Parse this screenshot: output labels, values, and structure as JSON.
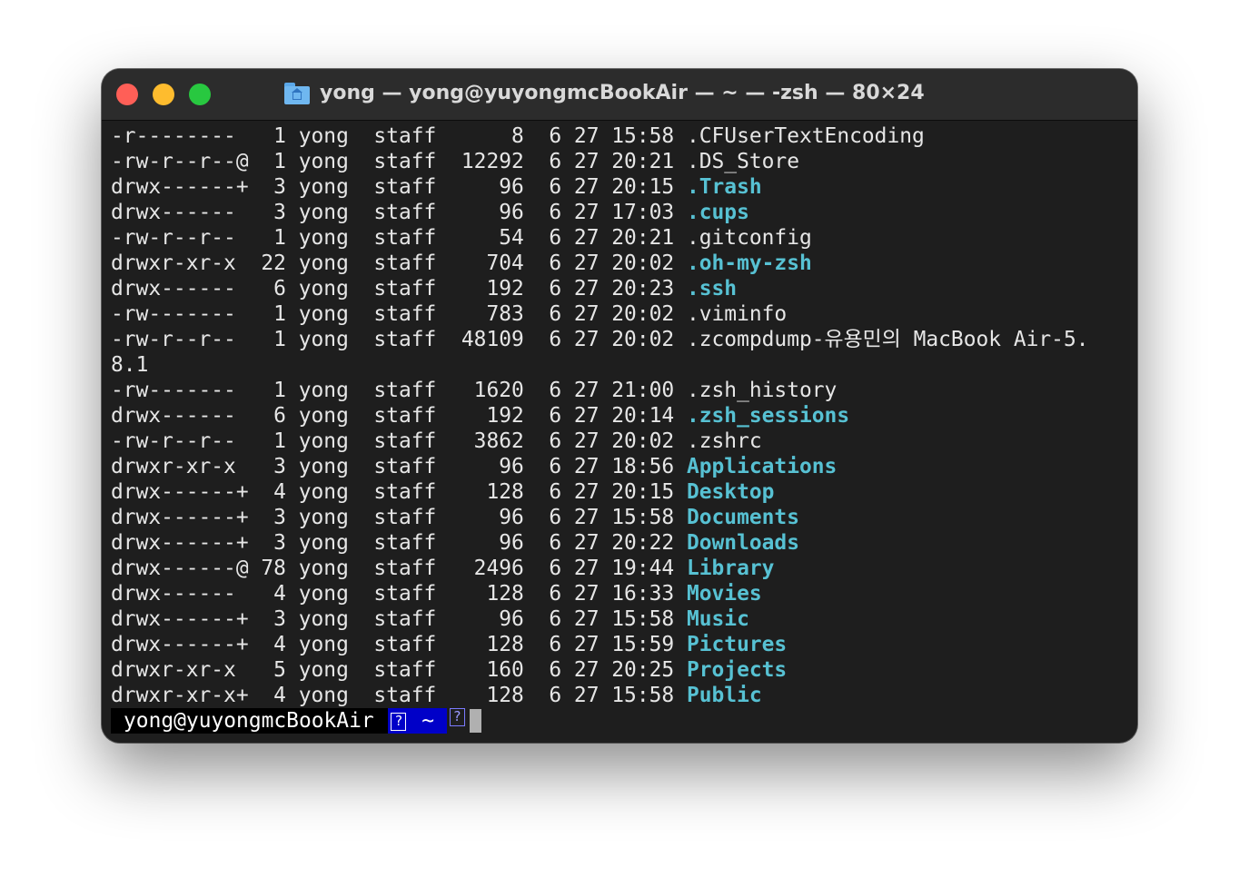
{
  "window": {
    "title": "yong — yong@yuyongmcBookAir — ~ — -zsh — 80×24",
    "title_icon": "home-folder-icon"
  },
  "colors": {
    "background": "#1e1e1e",
    "titlebar": "#2c2c2c",
    "text": "#e6e6e6",
    "directory": "#57c1d3",
    "prompt_dir_bg": "#0000c8"
  },
  "terminal": {
    "lines": [
      {
        "text": "-r--------   1 yong  staff      8  6 27 15:58 ",
        "name": ".CFUserTextEncoding",
        "dir": false
      },
      {
        "text": "-rw-r--r--@  1 yong  staff  12292  6 27 20:21 ",
        "name": ".DS_Store",
        "dir": false
      },
      {
        "text": "drwx------+  3 yong  staff     96  6 27 20:15 ",
        "name": ".Trash",
        "dir": true
      },
      {
        "text": "drwx------   3 yong  staff     96  6 27 17:03 ",
        "name": ".cups",
        "dir": true
      },
      {
        "text": "-rw-r--r--   1 yong  staff     54  6 27 20:21 ",
        "name": ".gitconfig",
        "dir": false
      },
      {
        "text": "drwxr-xr-x  22 yong  staff    704  6 27 20:02 ",
        "name": ".oh-my-zsh",
        "dir": true
      },
      {
        "text": "drwx------   6 yong  staff    192  6 27 20:23 ",
        "name": ".ssh",
        "dir": true
      },
      {
        "text": "-rw-------   1 yong  staff    783  6 27 20:02 ",
        "name": ".viminfo",
        "dir": false
      },
      {
        "text": "-rw-r--r--   1 yong  staff  48109  6 27 20:02 ",
        "name": ".zcompdump-유용민의 MacBook Air-5.",
        "dir": false
      },
      {
        "text": "8.1",
        "name": "",
        "dir": false
      },
      {
        "text": "-rw-------   1 yong  staff   1620  6 27 21:00 ",
        "name": ".zsh_history",
        "dir": false
      },
      {
        "text": "drwx------   6 yong  staff    192  6 27 20:14 ",
        "name": ".zsh_sessions",
        "dir": true
      },
      {
        "text": "-rw-r--r--   1 yong  staff   3862  6 27 20:02 ",
        "name": ".zshrc",
        "dir": false
      },
      {
        "text": "drwxr-xr-x   3 yong  staff     96  6 27 18:56 ",
        "name": "Applications",
        "dir": true
      },
      {
        "text": "drwx------+  4 yong  staff    128  6 27 20:15 ",
        "name": "Desktop",
        "dir": true
      },
      {
        "text": "drwx------+  3 yong  staff     96  6 27 15:58 ",
        "name": "Documents",
        "dir": true
      },
      {
        "text": "drwx------+  3 yong  staff     96  6 27 20:22 ",
        "name": "Downloads",
        "dir": true
      },
      {
        "text": "drwx------@ 78 yong  staff   2496  6 27 19:44 ",
        "name": "Library",
        "dir": true
      },
      {
        "text": "drwx------   4 yong  staff    128  6 27 16:33 ",
        "name": "Movies",
        "dir": true
      },
      {
        "text": "drwx------+  3 yong  staff     96  6 27 15:58 ",
        "name": "Music",
        "dir": true
      },
      {
        "text": "drwx------+  4 yong  staff    128  6 27 15:59 ",
        "name": "Pictures",
        "dir": true
      },
      {
        "text": "drwxr-xr-x   5 yong  staff    160  6 27 20:25 ",
        "name": "Projects",
        "dir": true
      },
      {
        "text": "drwxr-xr-x+  4 yong  staff    128  6 27 15:58 ",
        "name": "Public",
        "dir": true
      }
    ],
    "prompt": {
      "user_host": "yong@yuyongmcBookAir ",
      "glyph": "?",
      "dir": " ~ "
    }
  }
}
